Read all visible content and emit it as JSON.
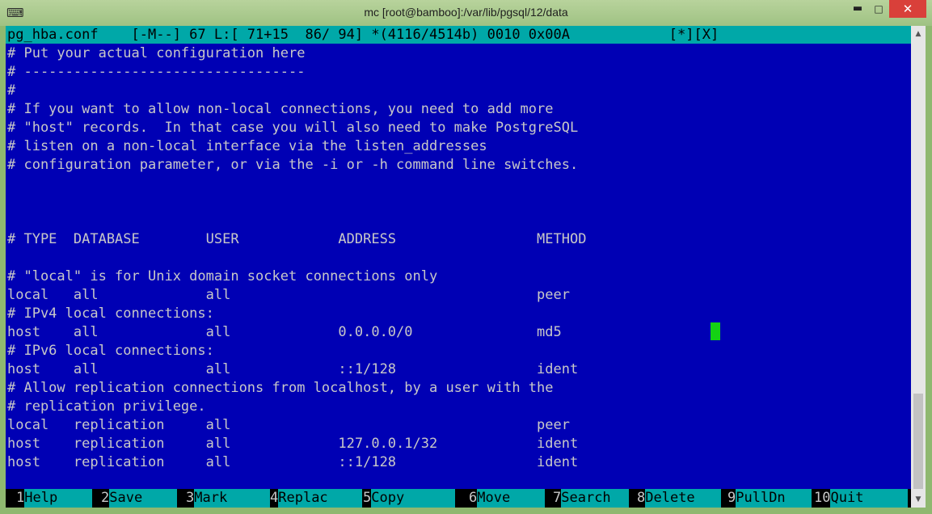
{
  "window": {
    "title": "mc [root@bamboo]:/var/lib/pgsql/12/data",
    "icon": "terminal-app-icon",
    "controls": {
      "minimize": "▬",
      "maximize": "□",
      "close": "✕"
    }
  },
  "editor": {
    "status_line": "pg_hba.conf    [-M--] 67 L:[ 71+15  86/ 94] *(4116/4514b) 0010 0x00A            [*][X]",
    "lines": [
      "# Put your actual configuration here",
      "# ----------------------------------",
      "#",
      "# If you want to allow non-local connections, you need to add more",
      "# \"host\" records.  In that case you will also need to make PostgreSQL",
      "# listen on a non-local interface via the listen_addresses",
      "# configuration parameter, or via the -i or -h command line switches.",
      "",
      "",
      "",
      "# TYPE  DATABASE        USER            ADDRESS                 METHOD",
      "",
      "# \"local\" is for Unix domain socket connections only",
      "local   all             all                                     peer",
      "# IPv4 local connections:",
      "host    all             all             0.0.0.0/0               md5",
      "# IPv6 local connections:",
      "host    all             all             ::1/128                 ident",
      "# Allow replication connections from localhost, by a user with the",
      "# replication privilege.",
      "local   replication     all                                     peer",
      "host    replication     all             127.0.0.1/32            ident",
      "host    replication     all             ::1/128                 ident"
    ]
  },
  "function_keys": [
    {
      "num": "1",
      "label": "Help"
    },
    {
      "num": "2",
      "label": "Save"
    },
    {
      "num": "3",
      "label": "Mark"
    },
    {
      "num": "4",
      "label": "Replac"
    },
    {
      "num": "5",
      "label": "Copy"
    },
    {
      "num": "6",
      "label": "Move"
    },
    {
      "num": "7",
      "label": "Search"
    },
    {
      "num": "8",
      "label": "Delete"
    },
    {
      "num": "9",
      "label": "PullDn"
    },
    {
      "num": "10",
      "label": "Quit"
    }
  ],
  "colors": {
    "background": "#0000b4",
    "text": "#c8c8c8",
    "status_bg": "#00a8a8",
    "cursor": "#14d214"
  }
}
